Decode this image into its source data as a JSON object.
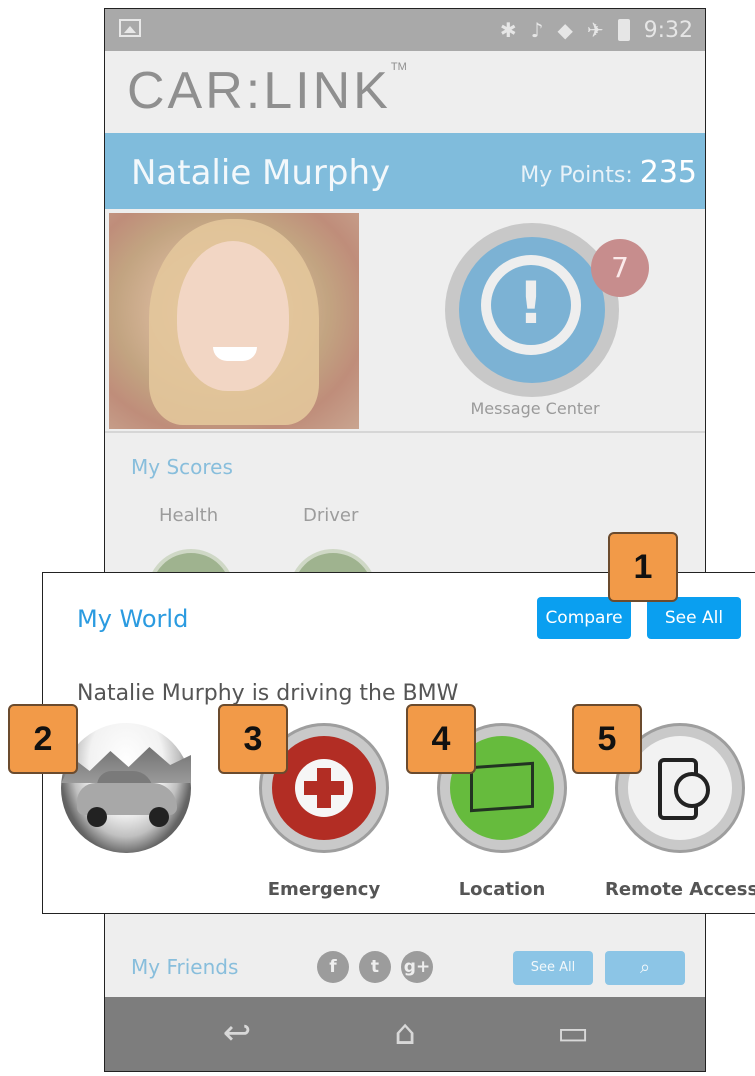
{
  "status_bar": {
    "time": "9:32",
    "icons": [
      "image-icon",
      "bluetooth-icon",
      "mute-icon",
      "wifi-icon",
      "airplane-icon",
      "battery-icon"
    ]
  },
  "app": {
    "logo": "CAR:LINK",
    "logo_tm": "TM"
  },
  "user": {
    "name": "Natalie Murphy",
    "points_label": "My Points:",
    "points_value": "235"
  },
  "message_center": {
    "label": "Message Center",
    "badge_count": "7"
  },
  "scores": {
    "title": "My Scores",
    "items": [
      {
        "label": "Health"
      },
      {
        "label": "Driver"
      }
    ]
  },
  "my_world": {
    "title": "My World",
    "compare_label": "Compare",
    "see_all_label": "See All",
    "driving_text": "Natalie Murphy is driving the BMW",
    "features": [
      {
        "label": "",
        "icon": "car-photo"
      },
      {
        "label": "Emergency",
        "icon": "emergency-cross-icon"
      },
      {
        "label": "Location",
        "icon": "map-icon"
      },
      {
        "label": "Remote Access",
        "icon": "remote-access-icon"
      }
    ]
  },
  "friends": {
    "title": "My Friends",
    "social": [
      "f",
      "t",
      "g+"
    ],
    "see_all_label": "See All",
    "search_icon": "search-icon"
  },
  "nav": {
    "icons": [
      "back-icon",
      "home-icon",
      "recents-icon"
    ]
  },
  "callouts": [
    "1",
    "2",
    "3",
    "4",
    "5"
  ],
  "colors": {
    "accent": "#0a9ff0",
    "name_bar": "#80bcdc",
    "callout": "#f29a48",
    "emergency": "#b22d24",
    "location": "#66bb3d"
  }
}
